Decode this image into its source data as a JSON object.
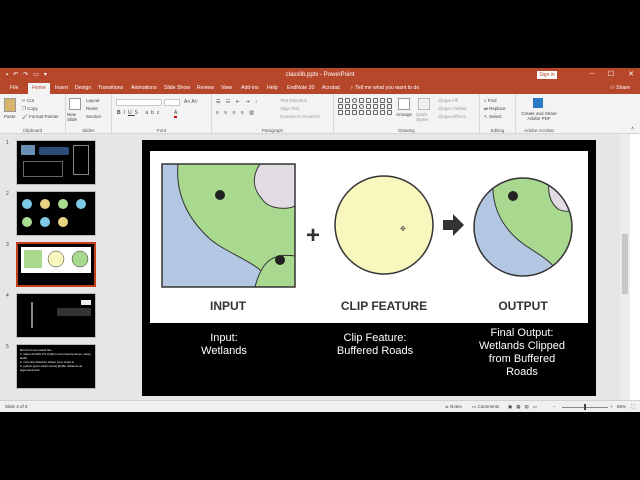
{
  "window": {
    "title": "classlib.pptx  -  PowerPoint",
    "sign_in": "Sign in",
    "min": "–",
    "max": "☐",
    "close": "✕"
  },
  "tabs": [
    "File",
    "Home",
    "Insert",
    "Design",
    "Transitions",
    "Animations",
    "Slide Show",
    "Review",
    "View",
    "Add-ins",
    "Help",
    "EndNote 20",
    "Acrobat"
  ],
  "tell_me": "Tell me what you want to do",
  "share": "Share",
  "ribbon": {
    "clipboard": {
      "paste": "Paste",
      "cut": "Cut",
      "copy": "Copy",
      "format_painter": "Format Painter",
      "label": "Clipboard"
    },
    "slides": {
      "new_slide": "New Slide",
      "layout": "Layout",
      "reset": "Reset",
      "section": "Section",
      "label": "Slides"
    },
    "font": {
      "label": "Font"
    },
    "paragraph": {
      "text_direction": "Text Direction",
      "align_text": "Align Text",
      "smartart": "Convert to SmartArt",
      "label": "Paragraph"
    },
    "drawing": {
      "arrange": "Arrange",
      "quick_styles": "Quick Styles",
      "shape_fill": "Shape Fill",
      "shape_outline": "Shape Outline",
      "shape_effects": "Shape Effects",
      "label": "Drawing"
    },
    "editing": {
      "find": "Find",
      "replace": "Replace",
      "select": "Select",
      "label": "Editing"
    },
    "acrobat": {
      "create": "Create and Share Adobe PDF",
      "label": "Adobe Acrobat"
    }
  },
  "thumbnails": [
    {
      "num": "1"
    },
    {
      "num": "2"
    },
    {
      "num": "3"
    },
    {
      "num": "4"
    },
    {
      "num": "5",
      "lines": [
        "Run from command line",
        "1. Open ArcGIS Pro Python Command prompt, navig",
        "andic",
        "2. cd to the directory where your script is",
        "3. python [your script name] [buffer distance as",
        "argument] and"
      ]
    }
  ],
  "slide": {
    "labels": {
      "input": "INPUT",
      "clip": "CLIP FEATURE",
      "output": "OUTPUT"
    },
    "captions": {
      "input": [
        "Input:",
        "Wetlands"
      ],
      "clip": [
        "Clip Feature:",
        "Buffered Roads"
      ],
      "output": [
        "Final Output:",
        "Wetlands Clipped",
        "from Buffered",
        "Roads"
      ]
    }
  },
  "status": {
    "slide_of": "Slide 3 of 5",
    "notes": "Notes",
    "comments": "Comments",
    "zoom": "86%"
  },
  "colors": {
    "accent": "#b7472a",
    "wetland_green": "#a8d98f",
    "water_blue": "#b4c7e2",
    "gray": "#e1dce3",
    "buffer": "#f8f7be"
  }
}
